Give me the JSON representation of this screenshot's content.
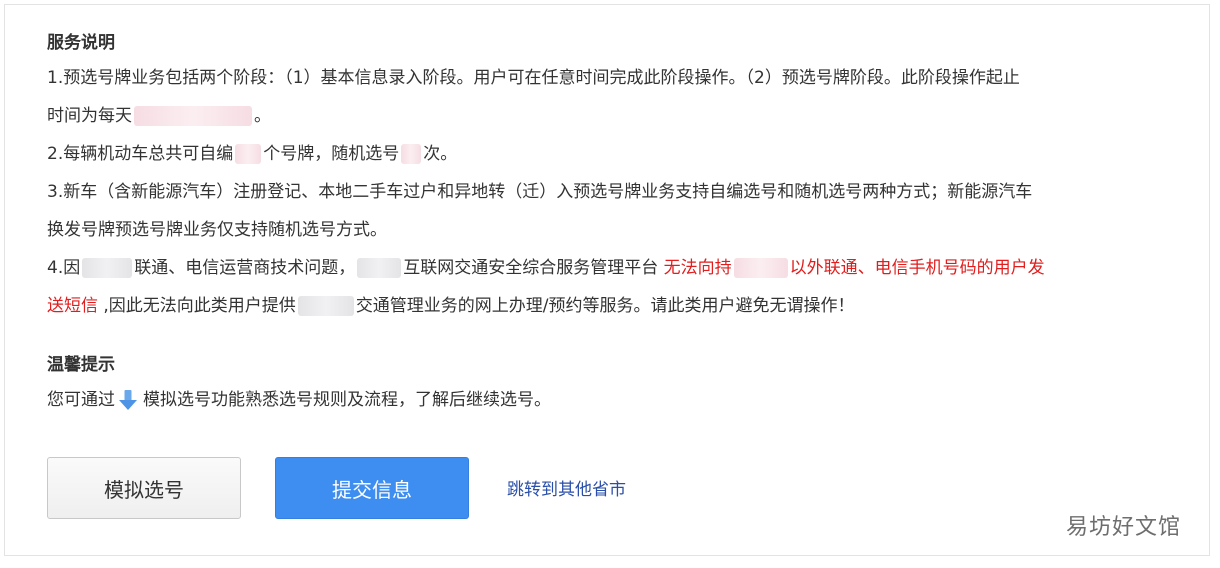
{
  "service": {
    "title": "服务说明",
    "item1": {
      "line1": "1.预选号牌业务包括两个阶段：（1）基本信息录入阶段。用户可在任意时间完成此阶段操作。（2）预选号牌阶段。此阶段操作起止",
      "line2_prefix": "时间为每天",
      "line2_suffix": "。"
    },
    "item2": {
      "prefix": "2.每辆机动车总共可自编",
      "middle": "个号牌，随机选号",
      "suffix": "次。"
    },
    "item3": {
      "line1": "3.新车（含新能源汽车）注册登记、本地二手车过户和异地转（迁）入预选号牌业务支持自编选号和随机选号两种方式；新能源汽车",
      "line2": "换发号牌预选号牌业务仅支持随机选号方式。"
    },
    "item4": {
      "prefix": "4.因",
      "part2": "联通、电信运营商技术问题，",
      "part3": "互联网交通安全综合服务管理平台 ",
      "red1": "无法向持",
      "red2": "以外联通、电信手机号码的用户发",
      "red3": "送短信",
      "part4": " ,因此无法向此类用户提供",
      "part5": "交通管理业务的网上办理/预约等服务。请此类用户避免无谓操作！"
    }
  },
  "tips": {
    "title": "温馨提示",
    "prefix": "您可通过",
    "suffix": "模拟选号功能熟悉选号规则及流程，了解后继续选号。"
  },
  "actions": {
    "simulate_label": "模拟选号",
    "submit_label": "提交信息",
    "jump_label": "跳转到其他省市"
  },
  "watermark": "易坊好文馆",
  "colors": {
    "accent_blue": "#3d8ef0",
    "warning_red": "#e21d1d",
    "link_blue": "#2a4fa8"
  },
  "icons": {
    "tips_arrow": "arrow-down-icon"
  }
}
